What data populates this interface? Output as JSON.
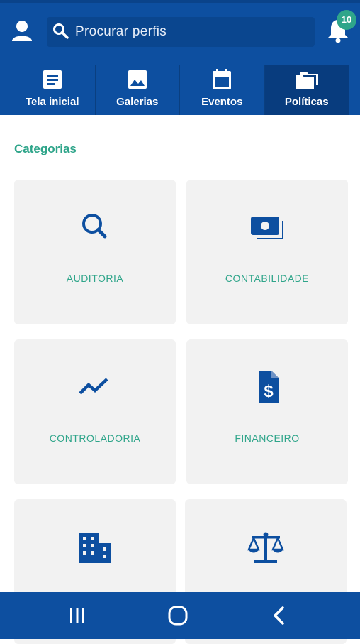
{
  "search": {
    "placeholder": "Procurar perfis"
  },
  "notifications": {
    "count": "10"
  },
  "tabs": [
    {
      "label": "Tela inicial",
      "icon": "article-icon",
      "active": false
    },
    {
      "label": "Galerias",
      "icon": "image-icon",
      "active": false
    },
    {
      "label": "Eventos",
      "icon": "calendar-icon",
      "active": false
    },
    {
      "label": "Políticas",
      "icon": "folders-icon",
      "active": true
    }
  ],
  "section_title": "Categorias",
  "categories": [
    {
      "label": "AUDITORIA",
      "icon": "search-icon"
    },
    {
      "label": "CONTABILIDADE",
      "icon": "money-icon"
    },
    {
      "label": "CONTROLADORIA",
      "icon": "trending-icon"
    },
    {
      "label": "FINANCEIRO",
      "icon": "invoice-icon"
    },
    {
      "label": "",
      "icon": "building-icon"
    },
    {
      "label": "",
      "icon": "scale-icon"
    }
  ],
  "colors": {
    "primary": "#0d4fa0",
    "accent": "#2fa58a",
    "card": "#f2f2f2"
  }
}
